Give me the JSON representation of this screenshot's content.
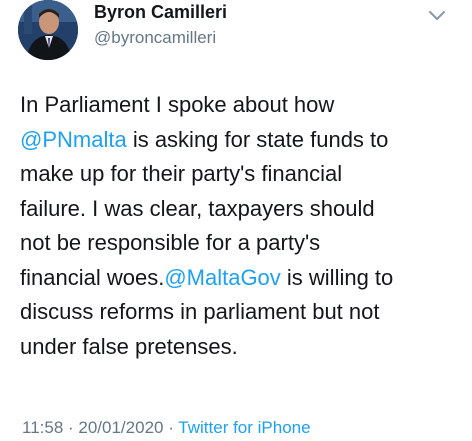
{
  "author": {
    "name": "Byron Camilleri",
    "handle": "@byroncamilleri"
  },
  "tweet": {
    "line1": "In Parliament I spoke about how",
    "mention1": "@PNmalta",
    "line2_rest": " is asking for state funds to",
    "line3": "make up for their party's financial",
    "line4": "failure. I was clear, taxpayers should",
    "line5": "not be responsible for a party's",
    "line6_pre": "financial woes.",
    "mention2": "@MaltaGov",
    "line6_rest": " is willing to",
    "line7": "discuss reforms in parliament but not",
    "line8": "under false pretenses."
  },
  "meta": {
    "time": "11:58",
    "separator1": " · ",
    "date": "20/01/2020",
    "separator2": " · ",
    "source": "Twitter for iPhone"
  },
  "icons": {
    "menu": "chevron-down-icon",
    "avatar": "avatar"
  },
  "colors": {
    "link": "#1da1f2",
    "secondary": "#657786",
    "text": "#14171a"
  }
}
